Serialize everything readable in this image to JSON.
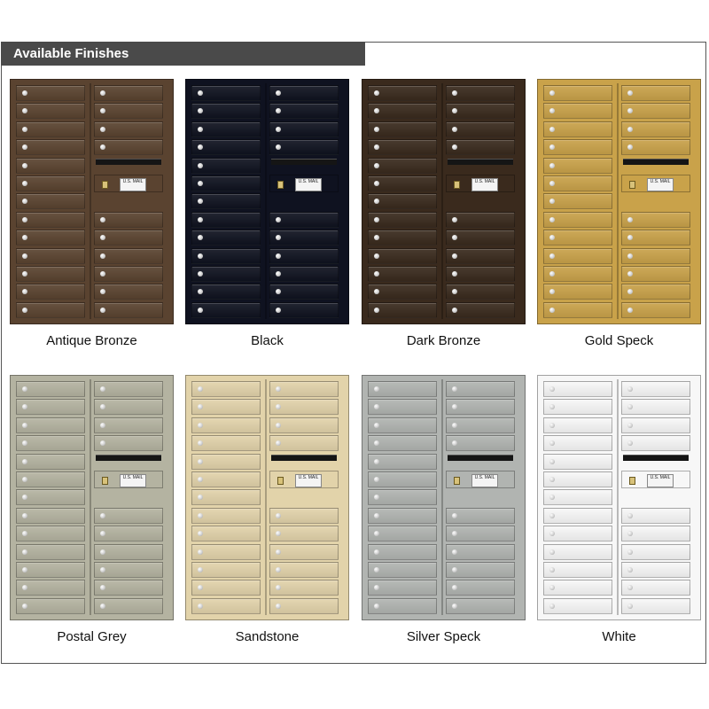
{
  "header": {
    "title": "Available Finishes"
  },
  "finishes": [
    {
      "name": "Antique Bronze",
      "color": "#5a4330"
    },
    {
      "name": "Black",
      "color": "#0f1220"
    },
    {
      "name": "Dark Bronze",
      "color": "#3a2a1d"
    },
    {
      "name": "Gold Speck",
      "color": "#c9a24a"
    },
    {
      "name": "Postal Grey",
      "color": "#b4b3a1"
    },
    {
      "name": "Sandstone",
      "color": "#e2d3aa"
    },
    {
      "name": "Silver Speck",
      "color": "#b1b4b1"
    },
    {
      "name": "White",
      "color": "#f7f7f7"
    }
  ],
  "plate_text": "U.S. MAIL"
}
